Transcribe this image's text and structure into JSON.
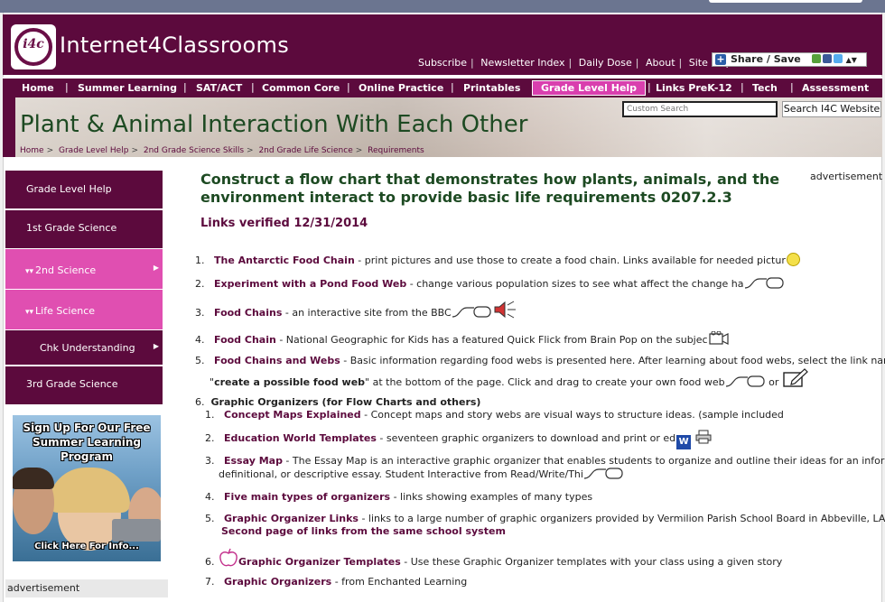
{
  "site": {
    "logo_text": "i4c",
    "brand": "Internet4Classrooms",
    "top_links": [
      "Subscribe",
      "Newsletter Index",
      "Daily Dose",
      "About",
      "Site Map"
    ],
    "share_label": "Share / Save"
  },
  "nav": {
    "items": [
      "Home",
      "Summer Learning",
      "SAT/ACT",
      "Common Core",
      "Online Practice",
      "Printables",
      "Grade Level Help",
      "Links PreK-12",
      "Tech",
      "Assessment"
    ],
    "active": "Grade Level Help"
  },
  "banner": {
    "title": "Plant & Animal Interaction With Each Other",
    "breadcrumb": [
      "Home",
      "Grade Level Help",
      "2nd Grade Science Skills",
      "2nd Grade Life Science",
      "Requirements"
    ],
    "search_placeholder": "Custom Search",
    "search_button": "Search I4C Website"
  },
  "sidebar": {
    "items": [
      {
        "label": "Grade Level Help"
      },
      {
        "label": "1st Grade Science"
      },
      {
        "label": "2nd Science"
      },
      {
        "label": "Life Science"
      },
      {
        "label": "Chk Understanding"
      },
      {
        "label": "3rd Grade Science"
      }
    ],
    "promo": {
      "headline": "Sign Up For Our Free Summer Learning Program",
      "cta": "Click Here For Info..."
    },
    "advertisement": "advertisement"
  },
  "main": {
    "heading": "Construct a flow chart that demonstrates how plants, animals, and the environment interact to provide basic life requirements 0207.2.3",
    "verified": "Links verified 12/31/2014",
    "advertisement": "advertisement",
    "items": [
      {
        "n": "1.",
        "title": "The Antarctic Food Chain",
        "desc": " - print pictures and use those to create a food chain. Links available for needed pictur"
      },
      {
        "n": "2.",
        "title": "Experiment with a Pond Food Web",
        "desc": " - change various population sizes to see what affect the change ha"
      },
      {
        "n": "3.",
        "title": "Food Chains",
        "desc": " - an interactive site from the BBC"
      },
      {
        "n": "4.",
        "title": "Food Chain",
        "desc": " - National Geographic for Kids has a featured Quick Flick from Brain Pop on the subjec"
      },
      {
        "n": "5.",
        "title": "Food Chains and Webs",
        "desc": " - Basic information regarding food webs is presented here. After learning about food webs, select the link named",
        "line2_pre": "\"",
        "line2_bold": "create a possible food web",
        "line2_post": "\" at the bottom of the page. Click and drag to create your own food web",
        "line2_or": " or"
      },
      {
        "n": "6.",
        "title": "Graphic Organizers (for Flow Charts and others)"
      }
    ],
    "subitems": [
      {
        "n": "1.",
        "title": "Concept Maps Explained",
        "desc": " - Concept maps and story webs are visual ways to structure ideas. (sample included"
      },
      {
        "n": "2.",
        "title": "Education World Templates",
        "desc": " - seventeen graphic organizers to download and print or ed"
      },
      {
        "n": "3.",
        "title": "Essay Map",
        "desc": " - The Essay Map is an interactive graphic organizer that enables students to organize and outline their ideas for an informationa",
        "line2": "definitional, or descriptive essay. Student Interactive from Read/Write/Thi"
      },
      {
        "n": "4.",
        "title": "Five main types of organizers",
        "desc": " - links showing examples of many types"
      },
      {
        "n": "5.",
        "title": "Graphic Organizer Links",
        "desc": " - links to a large number of graphic organizers provided by Vermilion Parish School Board in Abbeville, LA -",
        "line2": "Second page of links from the same school system"
      },
      {
        "n": "6.",
        "title": "Graphic Organizer Templates",
        "desc": " - Use these Graphic Organizer templates with your class using a given story"
      },
      {
        "n": "7.",
        "title": "Graphic Organizers",
        "desc": " - from Enchanted Learning"
      }
    ]
  }
}
